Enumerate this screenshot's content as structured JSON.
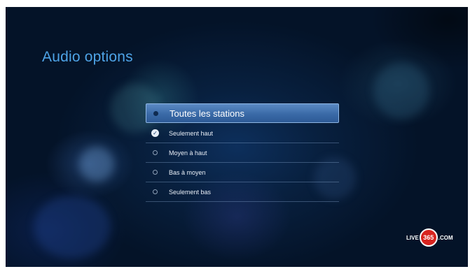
{
  "screen": {
    "title": "Audio options"
  },
  "menu": {
    "items": [
      {
        "label": "Toutes les stations",
        "state": "highlighted"
      },
      {
        "label": "Seulement haut",
        "state": "checked"
      },
      {
        "label": "Moyen à haut",
        "state": "unchecked"
      },
      {
        "label": "Bas à moyen",
        "state": "unchecked"
      },
      {
        "label": "Seulement bas",
        "state": "unchecked"
      }
    ]
  },
  "logo": {
    "prefix": "LIVE",
    "number": "365",
    "suffix": ".COM"
  },
  "colors": {
    "title": "#4ea3e6",
    "highlight": "#3a6aa7",
    "logo_red": "#d8241f"
  }
}
